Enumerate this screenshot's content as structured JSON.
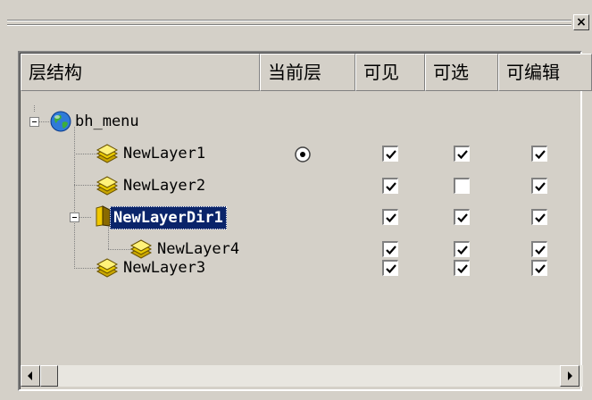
{
  "toolbar": {
    "close_glyph": "×"
  },
  "columns": [
    "层结构",
    "当前层",
    "可见",
    "可选",
    "可编辑"
  ],
  "tree": [
    {
      "label": "bh_menu",
      "icon": "globe-icon",
      "current": false,
      "visible": null,
      "selectable": null,
      "editable": null,
      "selected": false
    },
    {
      "label": "NewLayer1",
      "icon": "layer-stack-icon",
      "current": true,
      "visible": true,
      "selectable": true,
      "editable": true,
      "selected": false
    },
    {
      "label": "NewLayer2",
      "icon": "layer-stack-icon",
      "current": false,
      "visible": true,
      "selectable": false,
      "editable": true,
      "selected": false
    },
    {
      "label": "NewLayerDir1",
      "icon": "layer-folder-icon",
      "current": false,
      "visible": true,
      "selectable": true,
      "editable": true,
      "selected": true
    },
    {
      "label": "NewLayer4",
      "icon": "layer-stack-icon",
      "current": false,
      "visible": true,
      "selectable": true,
      "editable": true,
      "selected": false
    },
    {
      "label": "NewLayer3",
      "icon": "layer-stack-icon",
      "current": false,
      "visible": true,
      "selectable": true,
      "editable": true,
      "selected": false
    }
  ],
  "colors": {
    "selection": "#0a246a",
    "face": "#d4d0c8"
  }
}
